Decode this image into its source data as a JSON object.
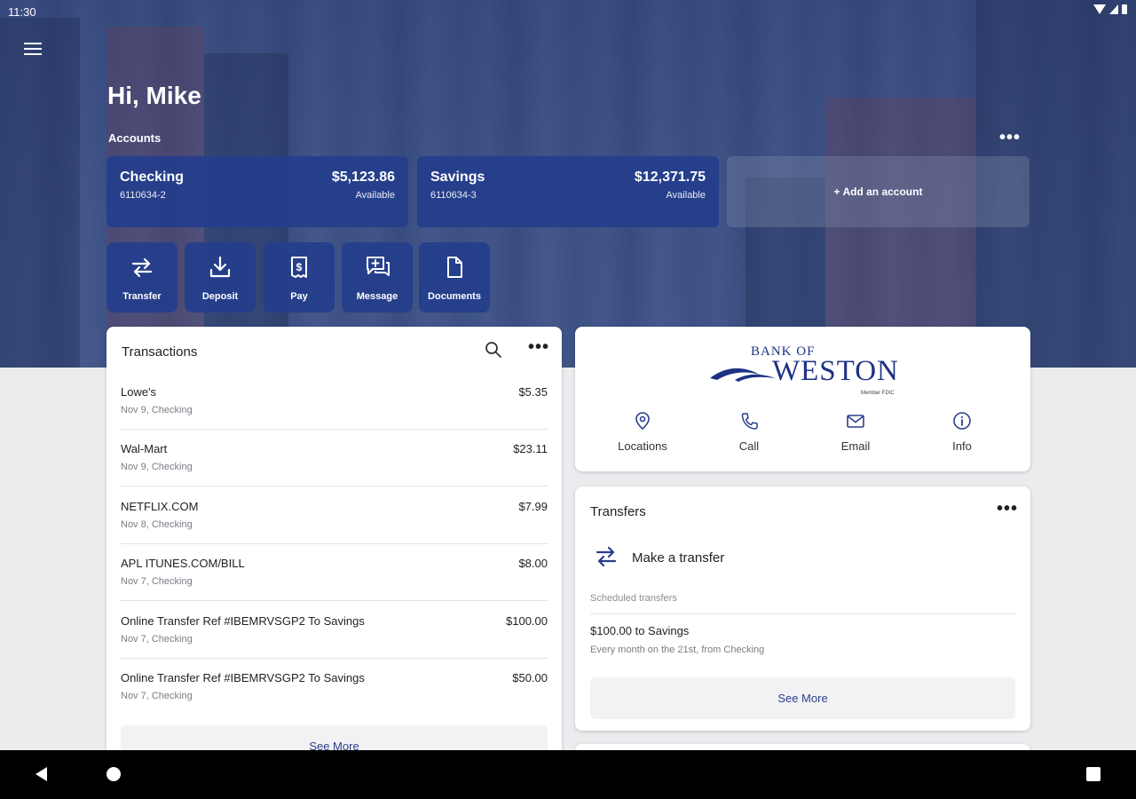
{
  "status_bar": {
    "time": "11:30"
  },
  "header": {
    "greeting": "Hi, Mike",
    "accounts_label": "Accounts",
    "more_label": "•••"
  },
  "accounts": [
    {
      "name": "Checking",
      "number": "6110634-2",
      "balance": "$5,123.86",
      "status": "Available"
    },
    {
      "name": "Savings",
      "number": "6110634-3",
      "balance": "$12,371.75",
      "status": "Available"
    }
  ],
  "add_account_label": "+ Add an account",
  "quick_actions": [
    {
      "label": "Transfer",
      "icon": "transfer-icon"
    },
    {
      "label": "Deposit",
      "icon": "deposit-icon"
    },
    {
      "label": "Pay",
      "icon": "bill-icon"
    },
    {
      "label": "Message",
      "icon": "message-icon"
    },
    {
      "label": "Documents",
      "icon": "document-icon"
    }
  ],
  "transactions": {
    "title": "Transactions",
    "more_label": "•••",
    "see_more": "See More",
    "items": [
      {
        "description": "Lowe's",
        "meta": "Nov 9, Checking",
        "amount": "$5.35"
      },
      {
        "description": "Wal-Mart",
        "meta": "Nov 9, Checking",
        "amount": "$23.11"
      },
      {
        "description": "NETFLIX.COM",
        "meta": "Nov 8, Checking",
        "amount": "$7.99"
      },
      {
        "description": "APL ITUNES.COM/BILL",
        "meta": "Nov 7, Checking",
        "amount": "$8.00"
      },
      {
        "description": "Online Transfer Ref #IBEMRVSGP2 To Savings",
        "meta": "Nov 7, Checking",
        "amount": "$100.00"
      },
      {
        "description": "Online Transfer Ref #IBEMRVSGP2 To Savings",
        "meta": "Nov 7, Checking",
        "amount": "$50.00"
      }
    ]
  },
  "bank": {
    "logo_top": "BANK OF",
    "logo_main": "WESTON",
    "logo_sub": "Member FDIC",
    "actions": [
      {
        "label": "Locations",
        "icon": "location-pin-icon"
      },
      {
        "label": "Call",
        "icon": "phone-icon"
      },
      {
        "label": "Email",
        "icon": "email-icon"
      },
      {
        "label": "Info",
        "icon": "info-icon"
      }
    ]
  },
  "transfers": {
    "title": "Transfers",
    "more_label": "•••",
    "make_transfer": "Make a transfer",
    "scheduled_label": "Scheduled transfers",
    "scheduled": [
      {
        "title": "$100.00 to Savings",
        "detail": "Every month on the 21st, from Checking"
      }
    ],
    "see_more": "See More"
  },
  "colors": {
    "primary": "#243e8c",
    "link": "#2c3e8a",
    "background": "#ececef"
  }
}
